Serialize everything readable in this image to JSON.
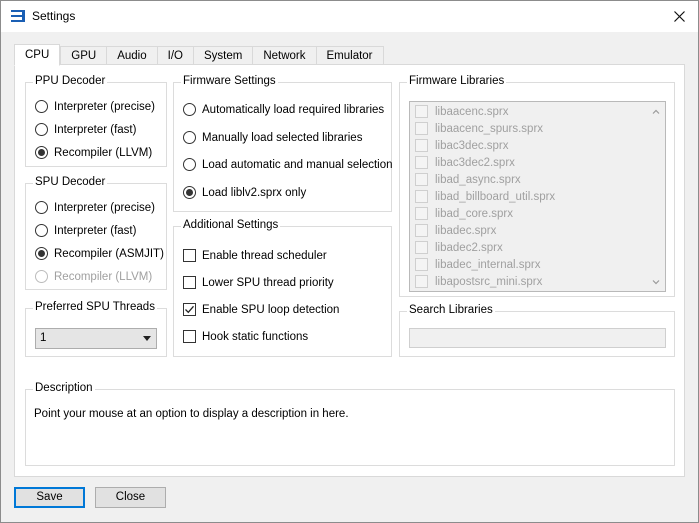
{
  "window": {
    "title": "Settings"
  },
  "tabs": [
    {
      "label": "CPU",
      "active": true
    },
    {
      "label": "GPU"
    },
    {
      "label": "Audio"
    },
    {
      "label": "I/O"
    },
    {
      "label": "System"
    },
    {
      "label": "Network"
    },
    {
      "label": "Emulator"
    }
  ],
  "ppu_decoder": {
    "title": "PPU Decoder",
    "options": [
      "Interpreter (precise)",
      "Interpreter (fast)",
      "Recompiler (LLVM)"
    ],
    "selected": 2
  },
  "spu_decoder": {
    "title": "SPU Decoder",
    "options": [
      "Interpreter (precise)",
      "Interpreter (fast)",
      "Recompiler (ASMJIT)",
      "Recompiler (LLVM)"
    ],
    "selected": 2
  },
  "preferred_spu_threads": {
    "title": "Preferred SPU Threads",
    "value": "1"
  },
  "firmware_settings": {
    "title": "Firmware Settings",
    "options": [
      "Automatically load required libraries",
      "Manually load selected libraries",
      "Load automatic and manual selection",
      "Load liblv2.sprx only"
    ],
    "selected": 3
  },
  "additional_settings": {
    "title": "Additional Settings",
    "options": [
      {
        "label": "Enable thread scheduler",
        "checked": false
      },
      {
        "label": "Lower SPU thread priority",
        "checked": false
      },
      {
        "label": "Enable SPU loop detection",
        "checked": true
      },
      {
        "label": "Hook static functions",
        "checked": false
      }
    ]
  },
  "firmware_libraries": {
    "title": "Firmware Libraries",
    "items": [
      "libaacenc.sprx",
      "libaacenc_spurs.sprx",
      "libac3dec.sprx",
      "libac3dec2.sprx",
      "libad_async.sprx",
      "libad_billboard_util.sprx",
      "libad_core.sprx",
      "libadec.sprx",
      "libadec2.sprx",
      "libadec_internal.sprx",
      "libapostsrc_mini.sprx"
    ]
  },
  "search_libraries": {
    "title": "Search Libraries",
    "value": ""
  },
  "description": {
    "title": "Description",
    "text": "Point your mouse at an option to display a description in here."
  },
  "buttons": {
    "save": "Save",
    "close": "Close"
  }
}
